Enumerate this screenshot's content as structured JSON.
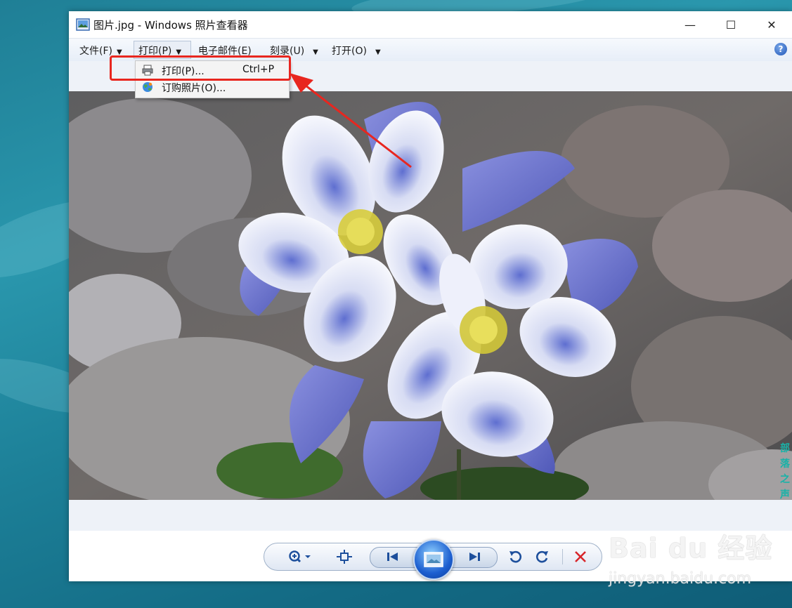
{
  "window": {
    "title": "图片.jpg - Windows 照片查看器",
    "controls": {
      "minimize": "—",
      "maximize": "☐",
      "close": "✕"
    }
  },
  "menu": {
    "file": "文件(F)",
    "print": "打印(P)",
    "email": "电子邮件(E)",
    "burn": "刻录(U)",
    "open": "打开(O)",
    "help_icon": "?"
  },
  "print_dropdown": {
    "items": [
      {
        "label": "打印(P)...",
        "shortcut": "Ctrl+P",
        "icon": "printer-icon"
      },
      {
        "label": "订购照片(O)...",
        "icon": "globe-icon"
      }
    ]
  },
  "image": {
    "subject": "blue columbine flowers on rocks"
  },
  "toolbar": {
    "zoom": "zoom-icon",
    "fit": "actual-size-icon",
    "previous": "previous-icon",
    "slideshow": "slideshow-icon",
    "next": "next-icon",
    "rotate_ccw": "rotate-counterclockwise-icon",
    "rotate_cw": "rotate-clockwise-icon",
    "delete": "delete-icon"
  },
  "watermark": {
    "logo": "Bai du 经验",
    "site": "jingyan.baidu.com"
  },
  "side_text": "部落之声",
  "colors": {
    "highlight": "#e8261f",
    "accent_blue": "#1d5fd0",
    "delete_red": "#d8262b"
  }
}
